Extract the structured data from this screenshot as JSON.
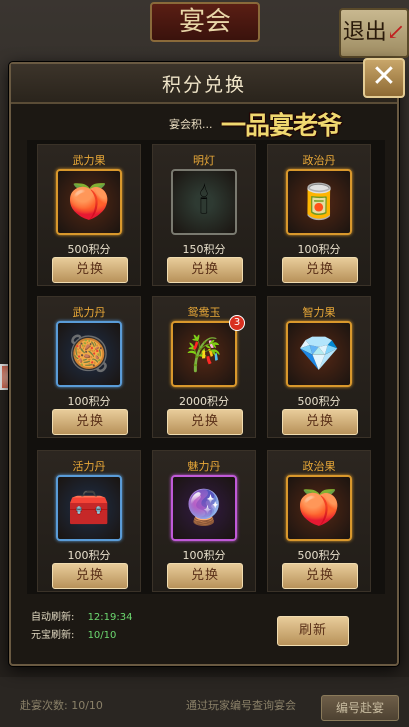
{
  "background": {
    "banquet_title": "宴会",
    "exit_label": "退出",
    "exit_arrow": "↙",
    "bottom_label": "赴宴次数:",
    "bottom_count": "10/10",
    "bottom_hint": "通过玩家编号查询宴会",
    "bottom_button": "编号赴宴"
  },
  "dialog": {
    "title": "积分兑换",
    "points_label": "宴会积...",
    "title_banner": "一品宴老爷",
    "close_icon": "close-icon"
  },
  "items": [
    {
      "name": "武力果",
      "cost": "500积分",
      "button": "兑换",
      "icon": "peach-fruit-icon",
      "frame": "orange",
      "glyph": "🍑"
    },
    {
      "name": "明灯",
      "cost": "150积分",
      "button": "兑换",
      "icon": "oil-lamp-icon",
      "frame": "gray",
      "glyph": "🕯"
    },
    {
      "name": "政治丹",
      "cost": "100积分",
      "button": "兑换",
      "icon": "pill-box-icon",
      "frame": "orange",
      "glyph": "🥫"
    },
    {
      "name": "武力丹",
      "cost": "100积分",
      "button": "兑换",
      "icon": "pill-box-icon",
      "frame": "blue",
      "glyph": "🥘"
    },
    {
      "name": "鸳鸯玉",
      "cost": "2000积分",
      "button": "兑换",
      "icon": "jade-icon",
      "frame": "orange",
      "glyph": "🎋",
      "badge": "3"
    },
    {
      "name": "智力果",
      "cost": "500积分",
      "button": "兑换",
      "icon": "fruit-icon",
      "frame": "orange",
      "glyph": "💎"
    },
    {
      "name": "活力丹",
      "cost": "100积分",
      "button": "兑换",
      "icon": "chest-icon",
      "frame": "blue",
      "glyph": "🧰"
    },
    {
      "name": "魅力丹",
      "cost": "100积分",
      "button": "兑换",
      "icon": "pill-box-icon",
      "frame": "purple",
      "glyph": "🔮"
    },
    {
      "name": "政治果",
      "cost": "500积分",
      "button": "兑换",
      "icon": "fruit-icon",
      "frame": "orange",
      "glyph": "🍑"
    }
  ],
  "footer": {
    "auto_refresh_label": "自动刷新:",
    "auto_refresh_time": "12:19:34",
    "ingot_refresh_label": "元宝刷新:",
    "ingot_refresh_count": "10/10",
    "refresh_button": "刷新"
  },
  "colors": {
    "accent_gold": "#e8cc9a",
    "item_name": "#e8a838",
    "timer_green": "#6cd870"
  }
}
